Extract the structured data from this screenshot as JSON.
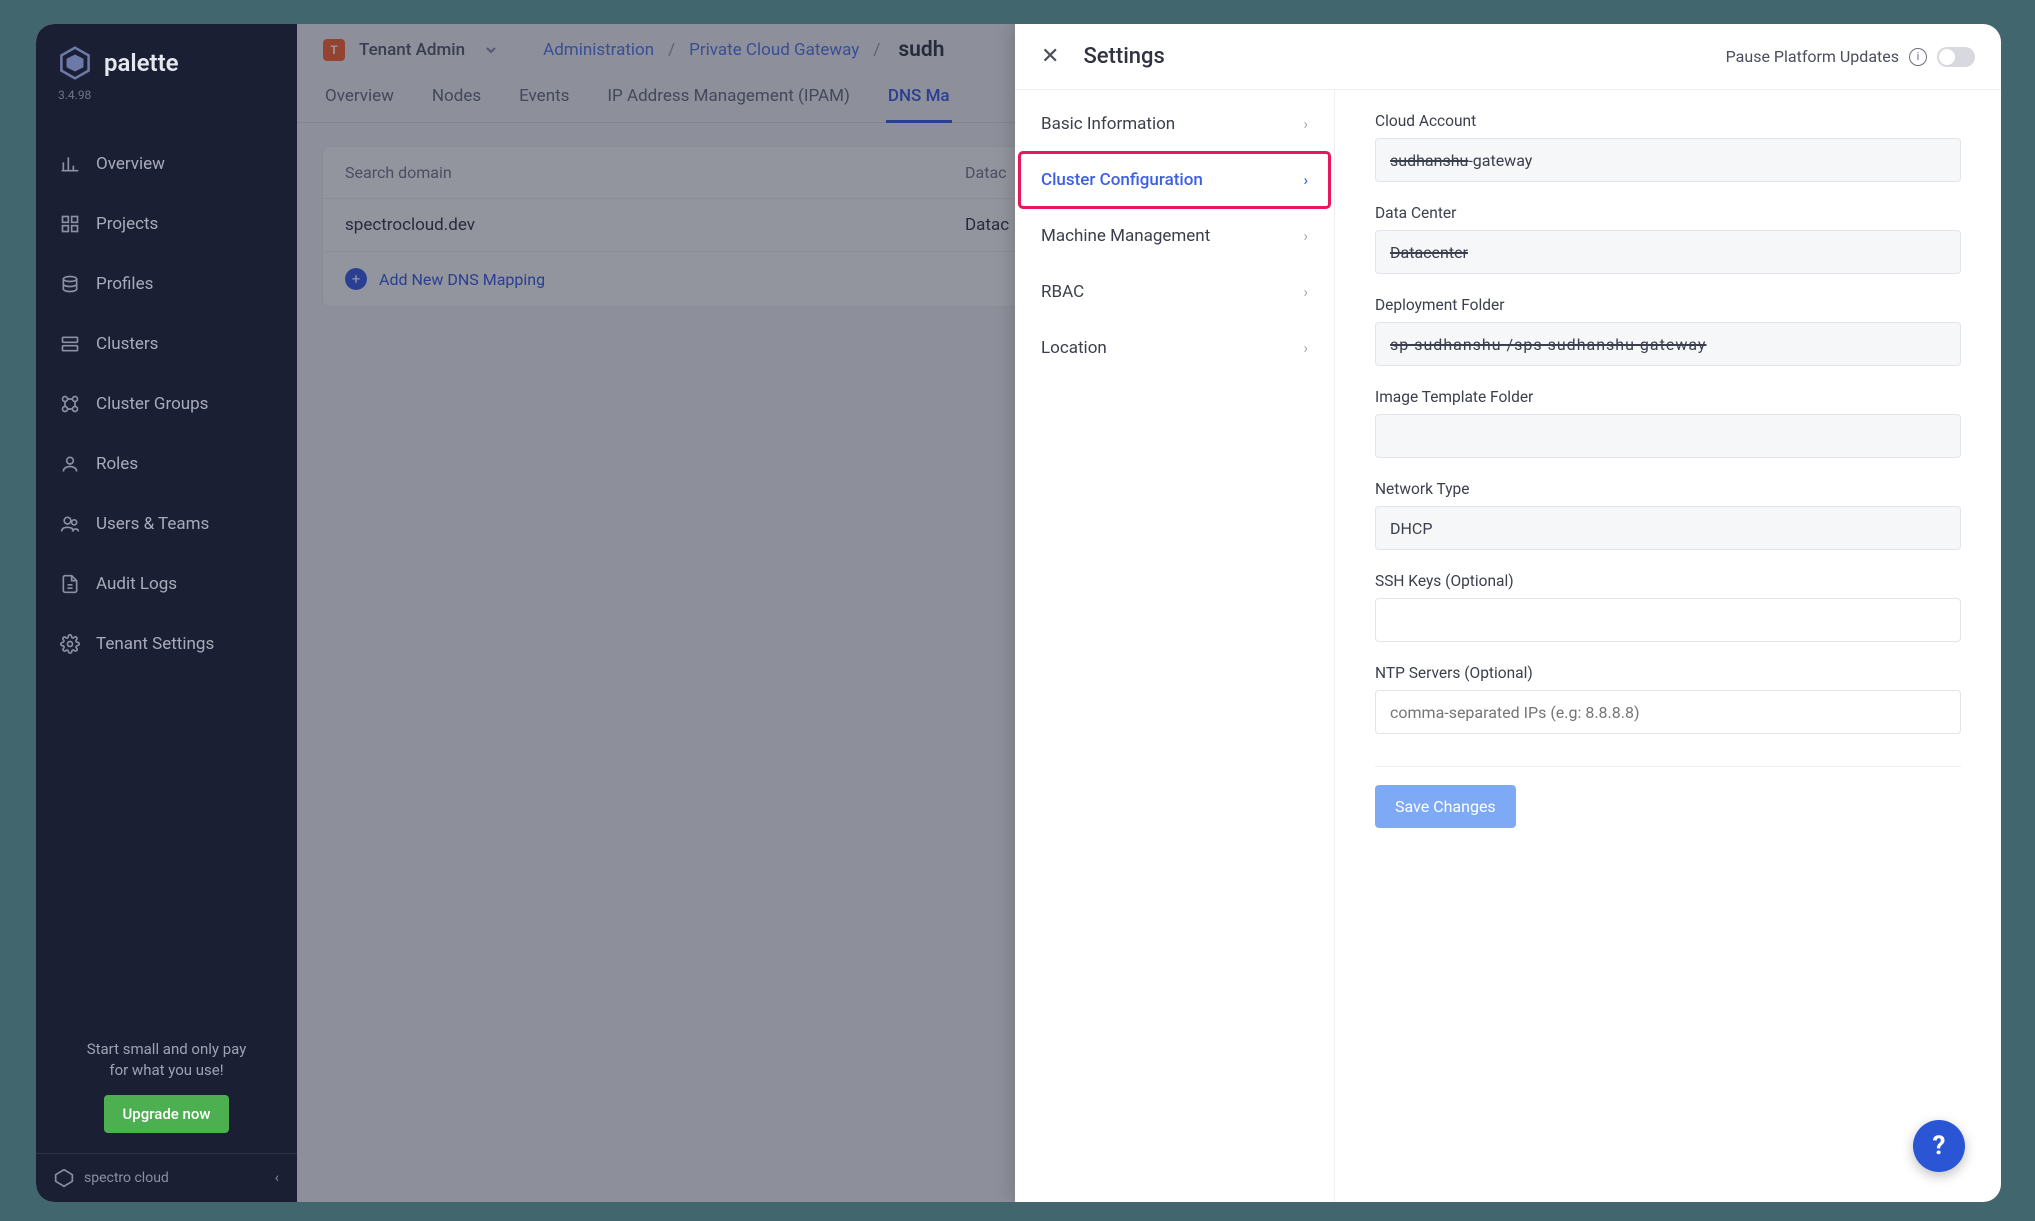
{
  "sidebar": {
    "product": "palette",
    "version": "3.4.98",
    "items": [
      {
        "label": "Overview"
      },
      {
        "label": "Projects"
      },
      {
        "label": "Profiles"
      },
      {
        "label": "Clusters"
      },
      {
        "label": "Cluster Groups"
      },
      {
        "label": "Roles"
      },
      {
        "label": "Users & Teams"
      },
      {
        "label": "Audit Logs"
      },
      {
        "label": "Tenant Settings"
      }
    ],
    "promo_line1": "Start small and only pay",
    "promo_line2": "for what you use!",
    "upgrade": "Upgrade now",
    "footer": "spectro cloud"
  },
  "topbar": {
    "scope_badge": "T",
    "scope_name": "Tenant Admin",
    "crumbs": [
      {
        "label": "Administration"
      },
      {
        "label": "Private Cloud Gateway"
      }
    ],
    "current": "sudh"
  },
  "tabs": [
    {
      "label": "Overview"
    },
    {
      "label": "Nodes"
    },
    {
      "label": "Events"
    },
    {
      "label": "IP Address Management (IPAM)"
    },
    {
      "label": "DNS Ma"
    }
  ],
  "table": {
    "col_domain": "Search domain",
    "col_dc": "Datac",
    "row_domain": "spectrocloud.dev",
    "row_dc": "Datac",
    "action": "Add New DNS Mapping"
  },
  "drawer": {
    "title": "Settings",
    "pause_label": "Pause Platform Updates",
    "nav": [
      {
        "label": "Basic Information"
      },
      {
        "label": "Cluster Configuration"
      },
      {
        "label": "Machine Management"
      },
      {
        "label": "RBAC"
      },
      {
        "label": "Location"
      }
    ],
    "form": {
      "cloud_account_label": "Cloud Account",
      "cloud_account_value_redacted": "sudhanshu",
      "cloud_account_value_tail": "-gateway",
      "data_center_label": "Data Center",
      "data_center_value": "Datacenter",
      "deployment_folder_label": "Deployment Folder",
      "deployment_folder_value": "sp  sudhanshu  /sps  sudhanshu  gateway",
      "image_template_label": "Image Template Folder",
      "image_template_value": "",
      "network_type_label": "Network Type",
      "network_type_value": "DHCP",
      "ssh_keys_label": "SSH Keys (Optional)",
      "ssh_keys_value": "",
      "ntp_label": "NTP Servers (Optional)",
      "ntp_placeholder": "comma-separated IPs (e.g: 8.8.8.8)",
      "save": "Save Changes"
    }
  }
}
